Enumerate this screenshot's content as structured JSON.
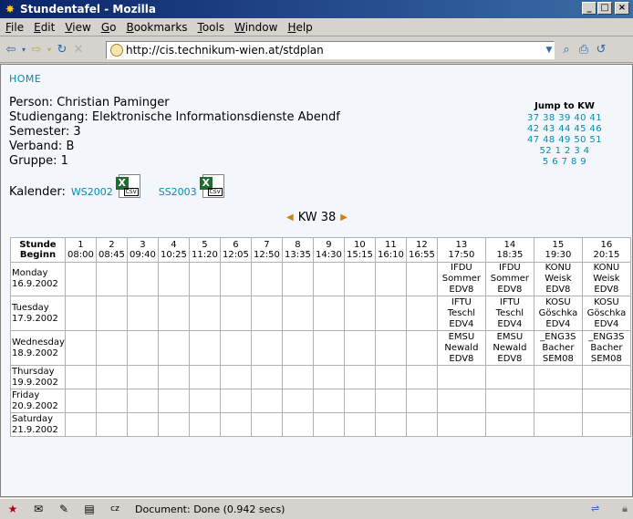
{
  "window": {
    "title": "Stundentafel - Mozilla",
    "buttons": [
      "_",
      "□",
      "×"
    ]
  },
  "menu": [
    "File",
    "Edit",
    "View",
    "Go",
    "Bookmarks",
    "Tools",
    "Window",
    "Help"
  ],
  "nav": {
    "url": "http://cis.technikum-wien.at/stdplan"
  },
  "page": {
    "home_link": "HOME",
    "person_label": "Person: Christian Paminger",
    "studiengang_label": "Studiengang: Elektronische Informationsdienste Abendf",
    "semester_label": "Semester: 3",
    "verband_label": "Verband: B",
    "gruppe_label": "Gruppe: 1",
    "kalender_label": "Kalender:",
    "ws_link": "WS2002",
    "ss_link": "SS2003",
    "csv_text": "CSV",
    "jump_title": "Jump to KW",
    "jump_lines": [
      "37 38 39 40 41",
      "42 43 44 45 46",
      "47 48 49 50 51",
      "52 1 2 3 4",
      "5 6 7 8 9"
    ],
    "kw_label": "KW 38"
  },
  "timetable": {
    "corner": [
      "Stunde",
      "Beginn"
    ],
    "hours": [
      {
        "n": "1",
        "t": "08:00"
      },
      {
        "n": "2",
        "t": "08:45"
      },
      {
        "n": "3",
        "t": "09:40"
      },
      {
        "n": "4",
        "t": "10:25"
      },
      {
        "n": "5",
        "t": "11:20"
      },
      {
        "n": "6",
        "t": "12:05"
      },
      {
        "n": "7",
        "t": "12:50"
      },
      {
        "n": "8",
        "t": "13:35"
      },
      {
        "n": "9",
        "t": "14:30"
      },
      {
        "n": "10",
        "t": "15:15"
      },
      {
        "n": "11",
        "t": "16:10"
      },
      {
        "n": "12",
        "t": "16:55"
      },
      {
        "n": "13",
        "t": "17:50"
      },
      {
        "n": "14",
        "t": "18:35"
      },
      {
        "n": "15",
        "t": "19:30"
      },
      {
        "n": "16",
        "t": "20:15"
      }
    ],
    "days": [
      {
        "name": "Monday",
        "date": "16.9.2002",
        "lessons": {
          "13": [
            "IFDU",
            "Sommer",
            "EDV8"
          ],
          "14": [
            "IFDU",
            "Sommer",
            "EDV8"
          ],
          "15": [
            "KONU",
            "Weisk",
            "EDV8"
          ],
          "16": [
            "KONU",
            "Weisk",
            "EDV8"
          ]
        }
      },
      {
        "name": "Tuesday",
        "date": "17.9.2002",
        "lessons": {
          "13": [
            "IFTU",
            "Teschl",
            "EDV4"
          ],
          "14": [
            "IFTU",
            "Teschl",
            "EDV4"
          ],
          "15": [
            "KOSU",
            "Göschka",
            "EDV4"
          ],
          "16": [
            "KOSU",
            "Göschka",
            "EDV4"
          ]
        }
      },
      {
        "name": "Wednesday",
        "date": "18.9.2002",
        "lessons": {
          "13": [
            "EMSU",
            "Newald",
            "EDV8"
          ],
          "14": [
            "EMSU",
            "Newald",
            "EDV8"
          ],
          "15": [
            "_ENG3S",
            "Bacher",
            "SEM08"
          ],
          "16": [
            "_ENG3S",
            "Bacher",
            "SEM08"
          ]
        }
      },
      {
        "name": "Thursday",
        "date": "19.9.2002",
        "lessons": {}
      },
      {
        "name": "Friday",
        "date": "20.9.2002",
        "lessons": {}
      },
      {
        "name": "Saturday",
        "date": "21.9.2002",
        "lessons": {}
      }
    ]
  },
  "status": {
    "text": "Document: Done (0.942 secs)"
  }
}
